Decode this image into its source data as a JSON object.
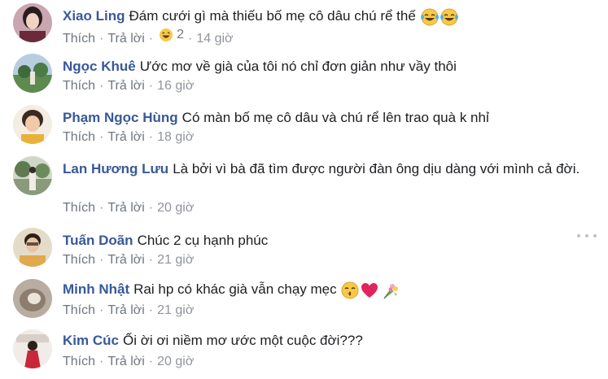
{
  "comments": [
    {
      "author": "Xiao Ling",
      "text": "Đám cưới gì mà thiếu bố mẹ cô dâu chú rể thế",
      "text_emojis": [
        "laughing-tears",
        "laughing-tears"
      ],
      "like_label": "Thích",
      "reply_label": "Trả lời",
      "reaction": "haha",
      "reaction_count": "2",
      "time": "14 giờ"
    },
    {
      "author": "Ngọc Khuê",
      "text": "Ước mơ về già của tôi nó chỉ đơn giản như vầy thôi",
      "like_label": "Thích",
      "reply_label": "Trả lời",
      "time": "16 giờ"
    },
    {
      "author": "Phạm Ngọc Hùng",
      "text": "Có màn bố mẹ cô dâu và chú rể lên trao quà k nhỉ",
      "like_label": "Thích",
      "reply_label": "Trả lời",
      "time": "18 giờ"
    },
    {
      "author": "Lan Hương Lưu",
      "text": "Là bởi vì bà đã tìm được người đàn ông dịu dàng với mình cả đời.",
      "like_label": "Thích",
      "reply_label": "Trả lời",
      "time": "20 giờ"
    },
    {
      "author": "Tuấn Doãn",
      "text": "Chúc 2 cụ hạnh phúc",
      "like_label": "Thích",
      "reply_label": "Trả lời",
      "time": "21 giờ"
    },
    {
      "author": "Minh Nhật",
      "text": "Rai hp có khác già vẫn chạy mẹc",
      "text_emojis": [
        "kissing-face",
        "red-heart",
        "bouquet"
      ],
      "like_label": "Thích",
      "reply_label": "Trả lời",
      "time": "21 giờ"
    },
    {
      "author": "Kim Cúc",
      "text": "Ối ời ơi niềm mơ ước một cuộc đời???",
      "like_label": "Thích",
      "reply_label": "Trả lời",
      "time": "20 giờ"
    }
  ],
  "separator": "·",
  "colors": {
    "author": "#385898",
    "text": "#1c1e21",
    "meta": "#90949c",
    "heart": "#e0245e",
    "emoji": "#f7c948"
  }
}
